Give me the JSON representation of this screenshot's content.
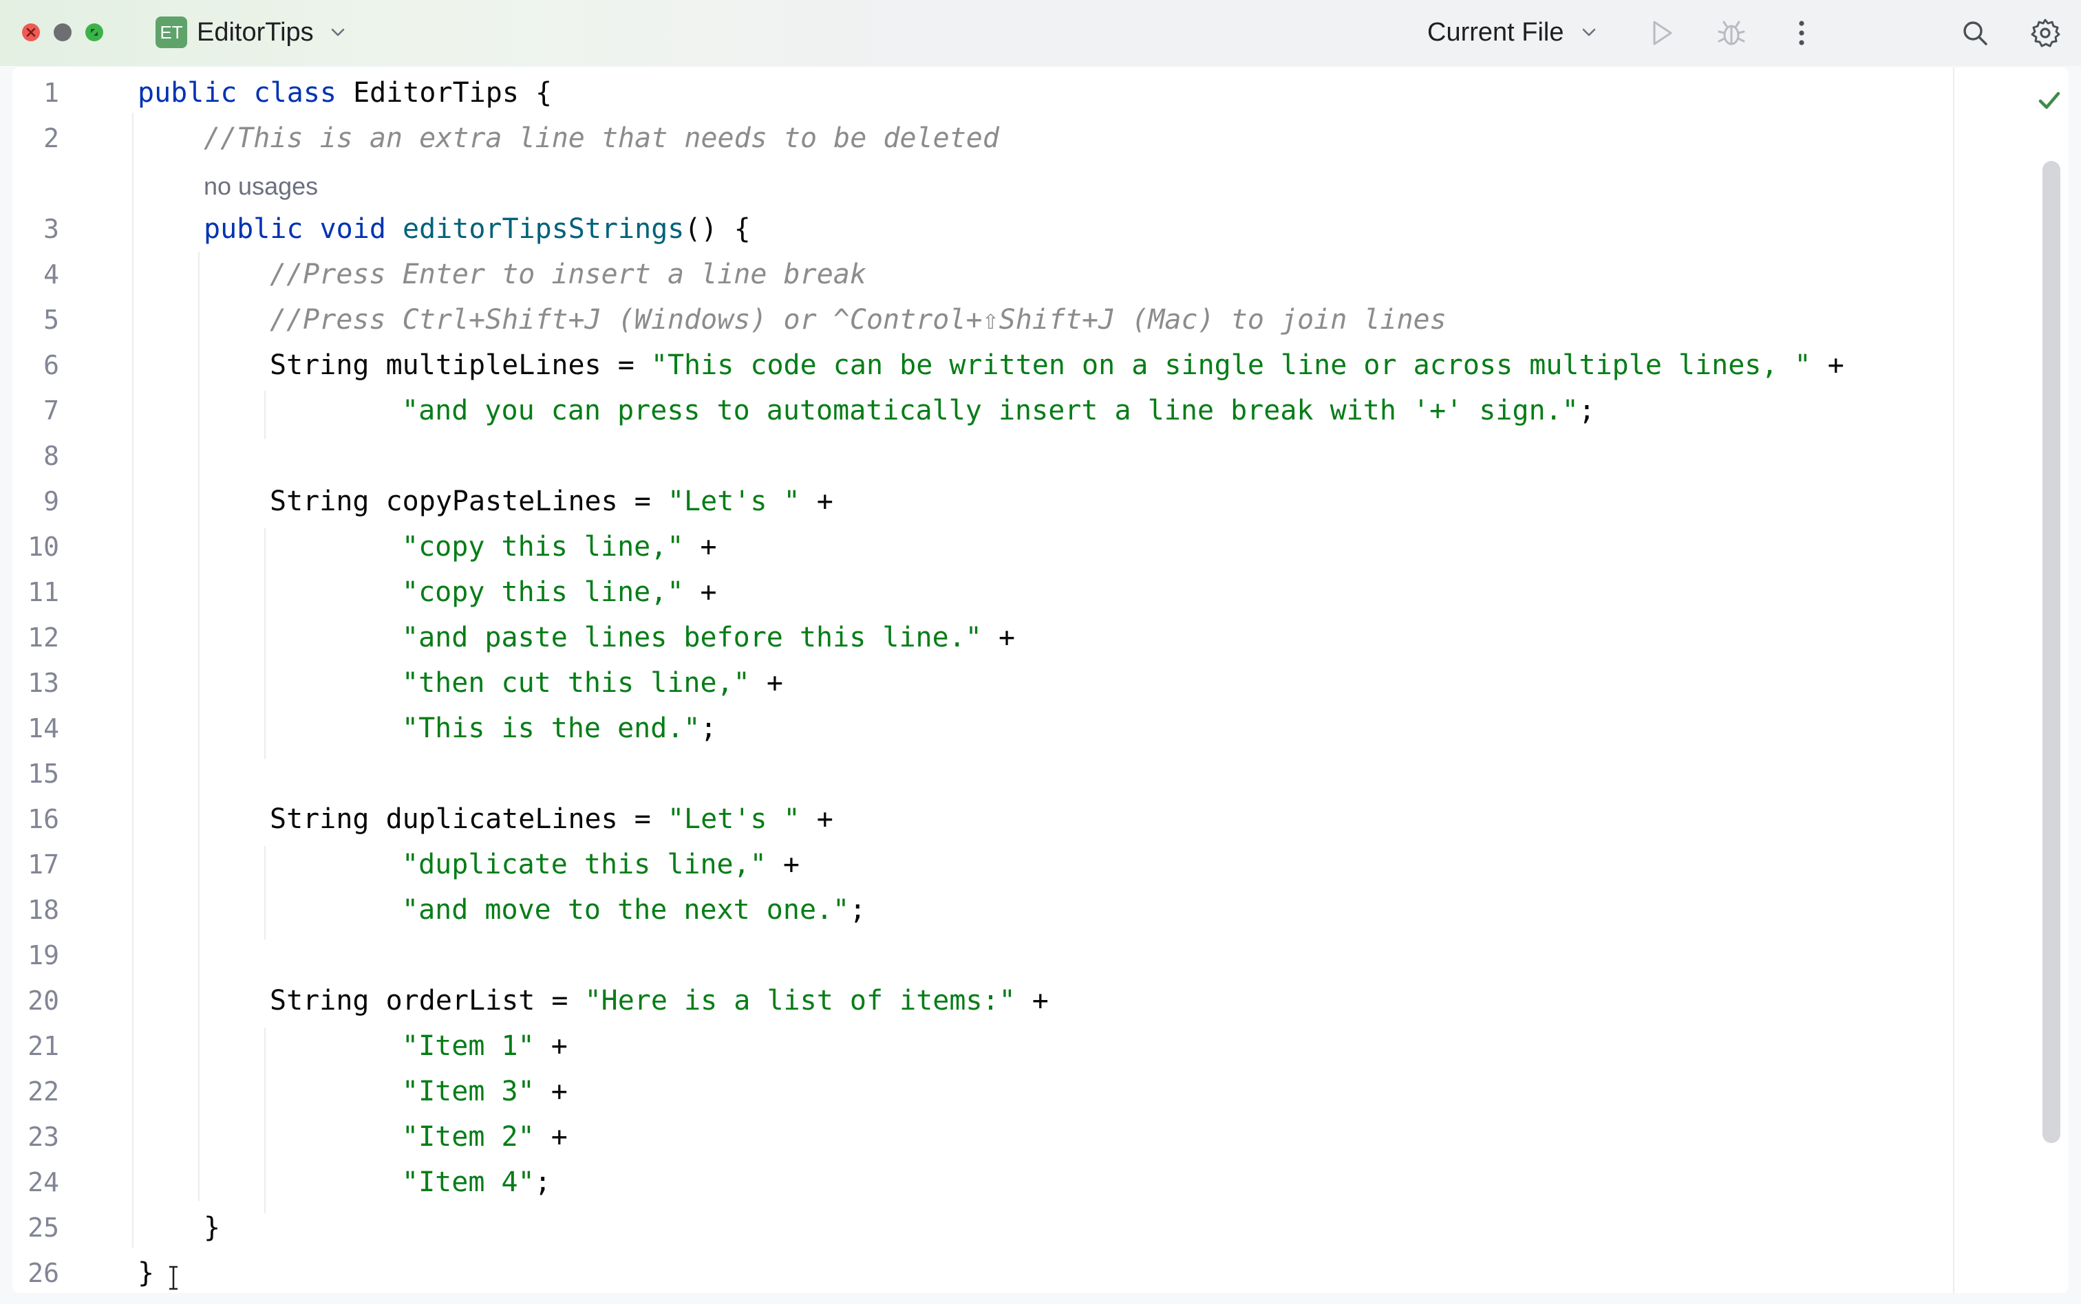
{
  "window": {
    "project_badge": "ET",
    "project_name": "EditorTips",
    "run_configuration": "Current File",
    "icons": {
      "close": "close-window-icon",
      "minimize": "minimize-window-icon",
      "zoom": "zoom-window-icon",
      "run": "run-icon",
      "debug": "debug-icon",
      "more": "more-vertical-icon",
      "search": "search-icon",
      "settings": "gear-icon"
    }
  },
  "editor": {
    "inlay_hint": "no usages",
    "inspection_status": "check-icon",
    "colors": {
      "keyword": "#0033b3",
      "method": "#00627a",
      "string": "#067d17",
      "comment": "#8c8c8c",
      "line_number": "#818594"
    },
    "line_numbers": [
      "1",
      "2",
      "3",
      "4",
      "5",
      "6",
      "7",
      "8",
      "9",
      "10",
      "11",
      "12",
      "13",
      "14",
      "15",
      "16",
      "17",
      "18",
      "19",
      "20",
      "21",
      "22",
      "23",
      "24",
      "25",
      "26"
    ],
    "lines": [
      {
        "kw": "public class ",
        "rest": "EditorTips {"
      },
      {
        "cm": "//This is an extra line that needs to be deleted"
      },
      {
        "kw": "public void ",
        "fn": "editorTipsStrings",
        "rest": "() {"
      },
      {
        "cm": "//Press Enter to insert a line break"
      },
      {
        "cm": "//Press Ctrl+Shift+J (Windows) or ^Control+⇧Shift+J (Mac) to join lines"
      },
      {
        "plain": "String multipleLines = ",
        "str": "\"This code can be written on a single line or across multiple lines, \"",
        "rest": " +"
      },
      {
        "str": "\"and you can press to automatically insert a line break with '+' sign.\"",
        "rest": ";"
      },
      {
        "plain": ""
      },
      {
        "plain": "String copyPasteLines = ",
        "str": "\"Let's \"",
        "rest": " +"
      },
      {
        "str": "\"copy this line,\"",
        "rest": " +"
      },
      {
        "str": "\"copy this line,\"",
        "rest": " +"
      },
      {
        "str": "\"and paste lines before this line.\"",
        "rest": " +"
      },
      {
        "str": "\"then cut this line,\"",
        "rest": " +"
      },
      {
        "str": "\"This is the end.\"",
        "rest": ";"
      },
      {
        "plain": ""
      },
      {
        "plain": "String duplicateLines = ",
        "str": "\"Let's \"",
        "rest": " +"
      },
      {
        "str": "\"duplicate this line,\"",
        "rest": " +"
      },
      {
        "str": "\"and move to the next one.\"",
        "rest": ";"
      },
      {
        "plain": ""
      },
      {
        "plain": "String orderList = ",
        "str": "\"Here is a list of items:\"",
        "rest": " +"
      },
      {
        "str": "\"Item 1\"",
        "rest": " +"
      },
      {
        "str": "\"Item 3\"",
        "rest": " +"
      },
      {
        "str": "\"Item 2\"",
        "rest": " +"
      },
      {
        "str": "\"Item 4\"",
        "rest": ";"
      },
      {
        "plain": "}"
      },
      {
        "plain": "}"
      }
    ]
  }
}
